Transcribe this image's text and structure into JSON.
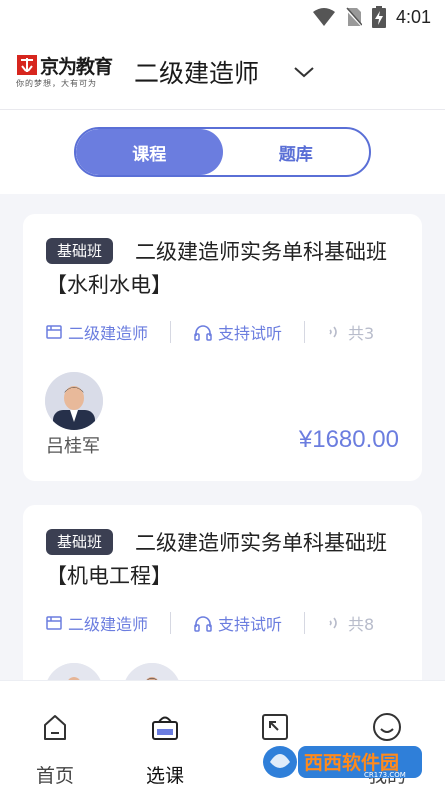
{
  "status_bar": {
    "time": "4:01"
  },
  "header": {
    "brand_name": "京为教育",
    "brand_slogan": "你的梦想，大有可为",
    "title": "二级建造师"
  },
  "segment_tabs": [
    {
      "label": "课程",
      "active": true
    },
    {
      "label": "题库",
      "active": false
    }
  ],
  "courses": [
    {
      "tag": "基础班",
      "title": "二级建造师实务单科基础班【水利水电】",
      "category": "二级建造师",
      "trial": "支持试听",
      "lessons": "共3",
      "teachers": [
        "吕桂军"
      ],
      "price": "¥1680.00"
    },
    {
      "tag": "基础班",
      "title": "二级建造师实务单科基础班【机电工程】",
      "category": "二级建造师",
      "trial": "支持试听",
      "lessons": "共8",
      "teachers": [
        "",
        ""
      ],
      "price": ""
    }
  ],
  "tabbar": [
    {
      "label": "首页",
      "icon": "home-icon",
      "active": false
    },
    {
      "label": "选课",
      "icon": "shopping-basket-icon",
      "active": true
    },
    {
      "label": "",
      "icon": "expand-icon",
      "active": false
    },
    {
      "label": "我的",
      "icon": "smile-face-icon",
      "active": false
    }
  ],
  "watermark": {
    "text": "西西软件园",
    "domain": "CR173.COM"
  },
  "colors": {
    "accent": "#6b7ddf",
    "tag_bg": "#3b3f52",
    "background": "#f4f5f9"
  }
}
